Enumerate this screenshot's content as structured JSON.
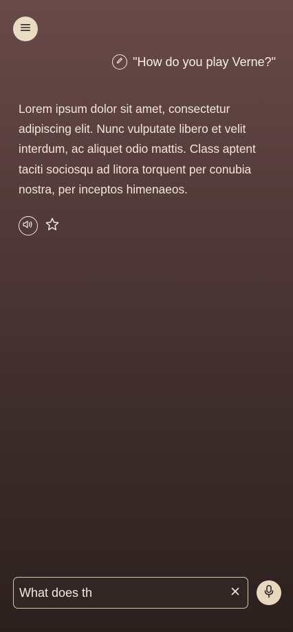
{
  "header": {
    "menu_icon": "hamburger-menu-icon"
  },
  "query": {
    "edit_icon": "pencil-icon",
    "text": "\"How do you play Verne?\""
  },
  "answer": {
    "text": "Lorem ipsum dolor sit amet, consectetur adipiscing elit. Nunc vulputate libero et velit interdum, ac aliquet odio mattis. Class aptent taciti sociosqu ad litora torquent per conubia nostra, per inceptos himenaeos."
  },
  "actions": {
    "speaker_icon": "speaker-icon",
    "favorite_icon": "star-outline-icon"
  },
  "composer": {
    "value": "What does th",
    "placeholder": "",
    "clear_icon": "close-icon",
    "mic_icon": "microphone-icon"
  },
  "colors": {
    "background_top": "#694a49",
    "background_bottom": "#2c201e",
    "accent": "#eadcc3",
    "text": "#f4e9df",
    "input_border": "#d6c9a6"
  }
}
